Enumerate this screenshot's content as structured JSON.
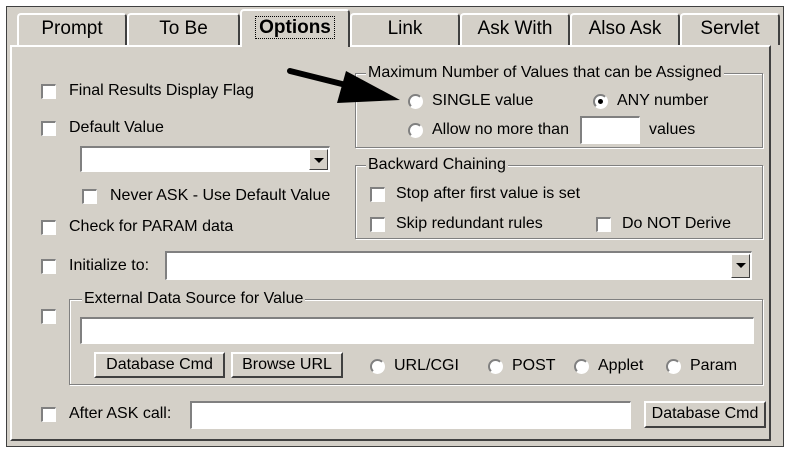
{
  "tabs": [
    "Prompt",
    "To Be",
    "Options",
    "Link",
    "Ask With",
    "Also Ask",
    "Servlet"
  ],
  "active_tab": "Options",
  "options": {
    "final_results": "Final Results Display Flag",
    "default_value": "Default Value",
    "default_value_select": "",
    "never_ask": "Never ASK - Use Default Value",
    "check_param": "Check for PARAM data",
    "initialize_to": "Initialize to:",
    "initialize_select": ""
  },
  "max_values": {
    "title": "Maximum Number of Values that can be Assigned",
    "single": "SINGLE value",
    "any": "ANY number",
    "allow": "Allow no more than",
    "allow_value": "",
    "values_suffix": "values",
    "selected": "ANY number"
  },
  "backward": {
    "title": "Backward Chaining",
    "stop": "Stop after first value is set",
    "skip": "Skip redundant rules",
    "do_not_derive": "Do NOT Derive"
  },
  "external": {
    "title": "External Data Source for Value",
    "input_value": "",
    "database_cmd": "Database Cmd",
    "browse_url": "Browse URL",
    "radios": [
      "URL/CGI",
      "POST",
      "Applet",
      "Param"
    ]
  },
  "after_ask": {
    "label": "After ASK call:",
    "input_value": "",
    "database_cmd": "Database Cmd"
  },
  "colors": {
    "face": "#d4d0c8",
    "shadow": "#808080",
    "dark": "#404040"
  }
}
